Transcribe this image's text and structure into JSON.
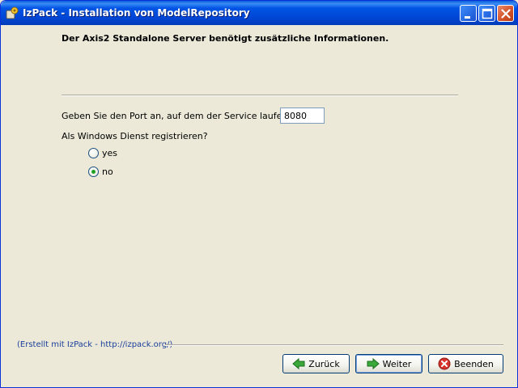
{
  "window": {
    "title": "IzPack - Installation von  ModelRepository"
  },
  "panel": {
    "header": "Der Axis2 Standalone Server benötigt zusätzliche Informationen.",
    "port_label": "Geben Sie den Port an, auf dem der Service laufen soll?",
    "port_value": "8080",
    "service_label": "Als Windows Dienst registrieren?",
    "options": [
      {
        "label": "yes",
        "selected": false
      },
      {
        "label": "no",
        "selected": true
      }
    ]
  },
  "footer": {
    "credit": "(Erstellt mit IzPack - http://izpack.org/)"
  },
  "buttons": {
    "back": "Zurück",
    "next": "Weiter",
    "quit": "Beenden"
  },
  "colors": {
    "titlebar": "#0055e5",
    "dialog_bg": "#ece9d8",
    "link": "#1a3e9c",
    "back_arrow": "#3aa83a",
    "quit_icon": "#d8322c"
  }
}
